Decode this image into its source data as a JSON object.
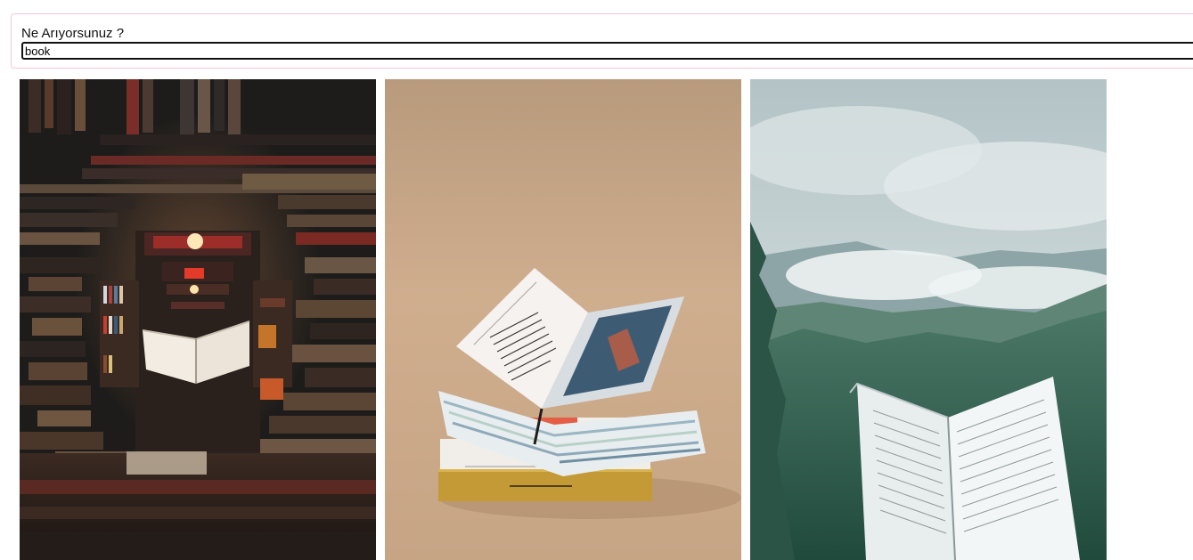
{
  "search": {
    "label": "Ne Arıyorsunuz ?",
    "value": "book"
  },
  "results": [
    {
      "subject": "library-tunnel-of-books-with-floating-open-book",
      "accent": "#2a2622"
    },
    {
      "subject": "open-magazine-stacked-on-books-beige-background",
      "accent": "#c9a98a"
    },
    {
      "subject": "open-book-held-before-misty-green-mountains",
      "accent": "#3f6a58"
    }
  ]
}
